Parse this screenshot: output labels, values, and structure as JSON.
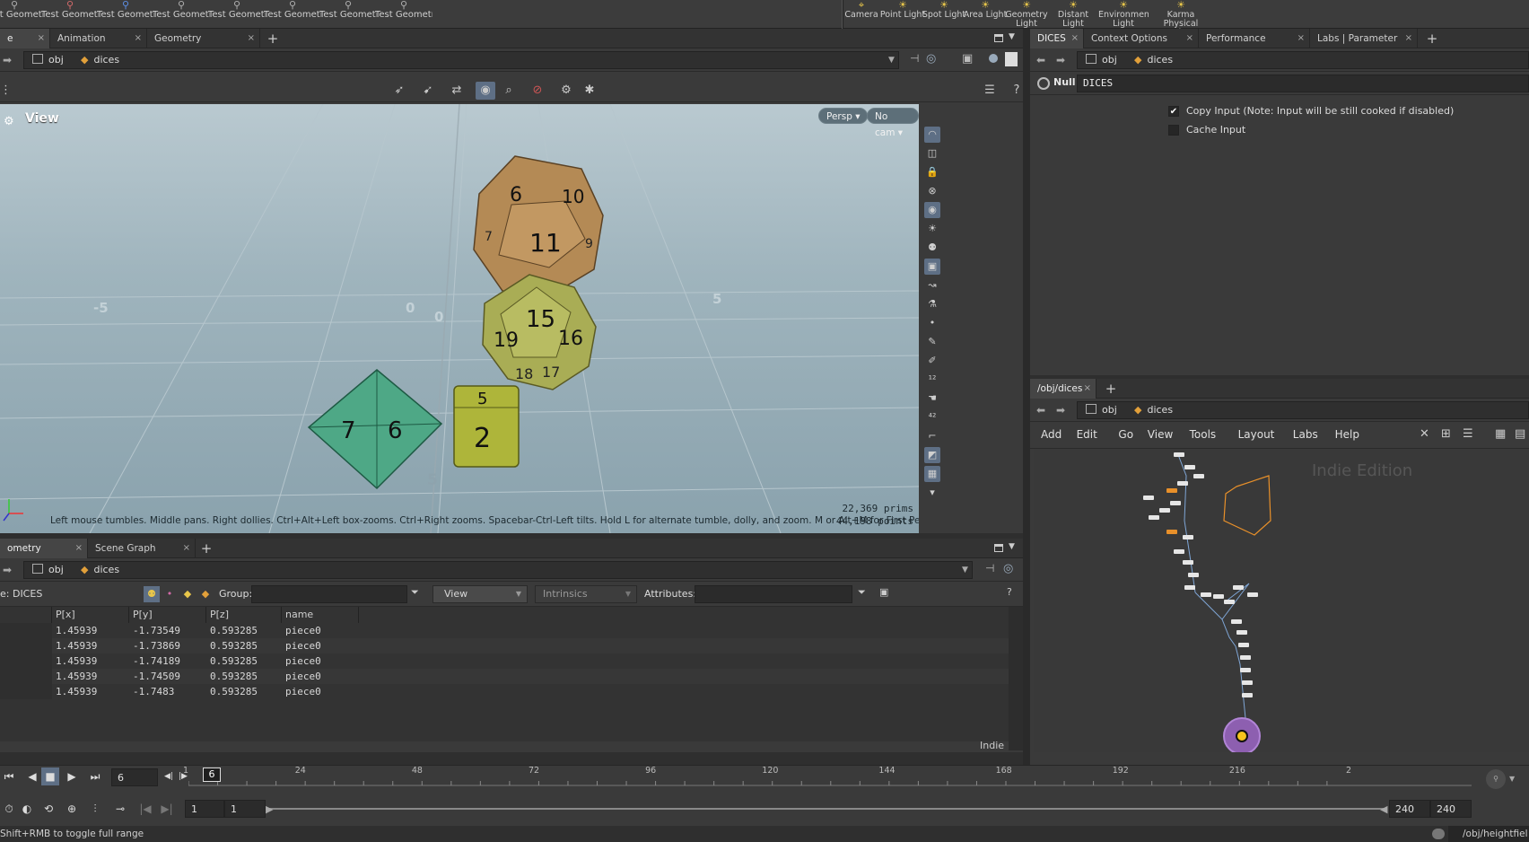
{
  "shelf": {
    "tools": [
      {
        "label": "Test Geometry: C...",
        "icon": "test-geometry-icon"
      },
      {
        "label": "Test Geometry: P...",
        "icon": "test-geometry-icon"
      },
      {
        "label": "Test Geometry: R...",
        "icon": "test-geometry-icon"
      },
      {
        "label": "Test Geometry: S...",
        "icon": "test-geometry-icon"
      },
      {
        "label": "Test Geometry: S...",
        "icon": "test-geometry-icon"
      },
      {
        "label": "Test Geometry: T...",
        "icon": "test-geometry-icon"
      },
      {
        "label": "Test Geometry: T...",
        "icon": "test-geometry-icon"
      },
      {
        "label": "Test Geometry: T...",
        "icon": "test-geometry-icon"
      }
    ],
    "lights": [
      {
        "label": "Camera",
        "icon": "camera-icon"
      },
      {
        "label": "Point Light",
        "icon": "point-light-icon"
      },
      {
        "label": "Spot Light",
        "icon": "spot-light-icon"
      },
      {
        "label": "Area Light",
        "icon": "area-light-icon"
      },
      {
        "label": "Geometry Light",
        "icon": "geometry-light-icon"
      },
      {
        "label": "Distant Light",
        "icon": "distant-light-icon"
      },
      {
        "label": "Environment Light",
        "icon": "environment-light-icon"
      },
      {
        "label": "Karma Physical Sky",
        "icon": "sky-icon"
      }
    ]
  },
  "left_tabs": [
    "e View",
    "Animation Editor",
    "Geometry Spreadsheet"
  ],
  "right_tabs": [
    "DICES",
    "Context Options Editor",
    "Performance Monitor",
    "Labs | Parameter Diff"
  ],
  "path": {
    "obj": "obj",
    "node": "dices"
  },
  "viewport": {
    "title": "View",
    "persp": "Persp",
    "cam": "No cam",
    "hint": "Left mouse tumbles. Middle pans. Right dollies. Ctrl+Alt+Left box-zooms. Ctrl+Right zooms. Spacebar-Ctrl-Left tilts. Hold L for alternate tumble, dolly, and zoom. M or Alt+M for First Person Naviga...",
    "prims": "22,369",
    "prims_label": "prims",
    "points": "44,198",
    "points_label": "points",
    "grid_labels": [
      "-5",
      "0",
      "5",
      "0",
      "5"
    ],
    "dice": {
      "d12": [
        "6",
        "10",
        "11",
        "7",
        "9"
      ],
      "d20": [
        "15",
        "19",
        "16",
        "18",
        "17"
      ],
      "d8": [
        "7",
        "6"
      ],
      "d6": [
        "5",
        "2"
      ]
    }
  },
  "params": {
    "type": "Null",
    "name": "DICES",
    "copy_input": "Copy Input (Note: Input will be still cooked if disabled)",
    "copy_input_checked": true,
    "cache_input": "Cache Input",
    "cache_input_checked": false
  },
  "network": {
    "tab": "/obj/dices",
    "menu": [
      "Add",
      "Edit",
      "Go",
      "View",
      "Tools",
      "Layout",
      "Labs",
      "Help"
    ],
    "watermark": "Indie Edition"
  },
  "spreadsheet": {
    "tabs": [
      "ometry Spreadsheet",
      "Scene Graph Layers"
    ],
    "node_label": "e: DICES",
    "group_label": "Group:",
    "view_label": "View",
    "intrinsics_label": "Intrinsics",
    "attributes_label": "Attributes:",
    "columns": [
      "P[x]",
      "P[y]",
      "P[z]",
      "name"
    ],
    "rows": [
      [
        "1.45939",
        "-1.73549",
        "0.593285",
        "piece0"
      ],
      [
        "1.45939",
        "-1.73869",
        "0.593285",
        "piece0"
      ],
      [
        "1.45939",
        "-1.74189",
        "0.593285",
        "piece0"
      ],
      [
        "1.45939",
        "-1.74509",
        "0.593285",
        "piece0"
      ],
      [
        "1.45939",
        "-1.7483",
        "0.593285",
        "piece0"
      ]
    ],
    "indie": "Indie"
  },
  "timeline": {
    "frame": "6",
    "marker": "6",
    "ticks": [
      "1",
      "24",
      "48",
      "72",
      "96",
      "120",
      "144",
      "168",
      "192",
      "216",
      "2"
    ],
    "start": "1",
    "start2": "1",
    "end": "240",
    "end2": "240"
  },
  "status": {
    "left": "Shift+RMB to toggle full range",
    "right": "/obj/heightfiel"
  }
}
